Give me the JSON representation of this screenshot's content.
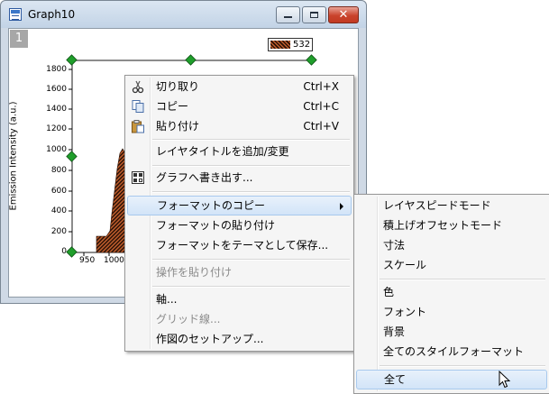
{
  "window": {
    "title": "Graph10",
    "layer_number": "1"
  },
  "legend": {
    "label": "532"
  },
  "axes": {
    "ylabel": "Emission Intensity (a.u.)",
    "yticks": [
      "1800",
      "1600",
      "1400",
      "1200",
      "1000",
      "800",
      "600",
      "400",
      "200",
      "0"
    ],
    "xticks": [
      "950",
      "1000"
    ]
  },
  "context_menu": {
    "cut": {
      "label": "切り取り",
      "shortcut": "Ctrl+X"
    },
    "copy": {
      "label": "コピー",
      "shortcut": "Ctrl+C"
    },
    "paste": {
      "label": "貼り付け",
      "shortcut": "Ctrl+V"
    },
    "add_layer_title": {
      "label": "レイヤタイトルを追加/変更"
    },
    "export_graph": {
      "label": "グラフへ書き出す..."
    },
    "copy_format": {
      "label": "フォーマットのコピー"
    },
    "paste_format": {
      "label": "フォーマットの貼り付け"
    },
    "save_format_theme": {
      "label": "フォーマットをテーマとして保存..."
    },
    "paste_operation": {
      "label": "操作を貼り付け"
    },
    "axis": {
      "label": "軸..."
    },
    "grid_lines": {
      "label": "グリッド線..."
    },
    "plot_setup": {
      "label": "作図のセットアップ..."
    }
  },
  "submenu": {
    "layer_speed_mode": "レイヤスピードモード",
    "stack_offset_mode": "積上げオフセットモード",
    "dimensions": "寸法",
    "scale": "スケール",
    "color": "色",
    "font": "フォント",
    "background": "背景",
    "all_style_formats": "全てのスタイルフォーマット",
    "all": "全て"
  }
}
